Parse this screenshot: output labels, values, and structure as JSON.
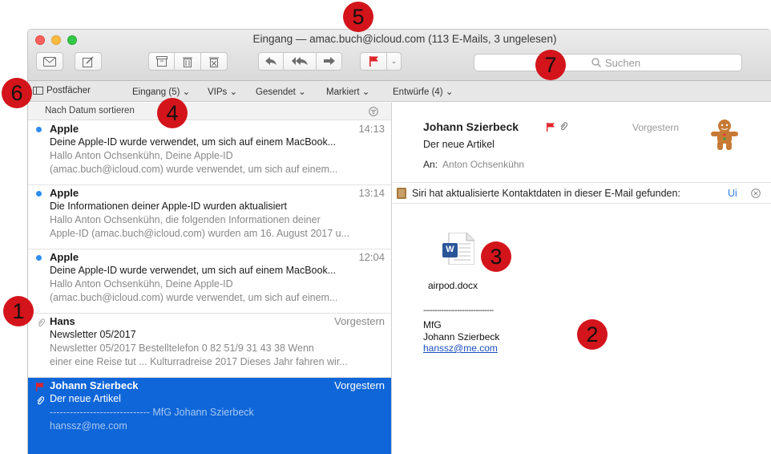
{
  "window": {
    "title": "Eingang — amac.buch@icloud.com (113 E-Mails, 3 ungelesen)"
  },
  "toolbar": {
    "buttons": [
      "new-message",
      "compose",
      "archive",
      "delete",
      "junk",
      "reply",
      "reply-all",
      "forward",
      "flag",
      "flag-menu"
    ],
    "search_placeholder": "Suchen"
  },
  "favorites": {
    "mailboxes": "Postfächer",
    "inbox": "Eingang (5)",
    "vips": "VIPs",
    "sent": "Gesendet",
    "flagged": "Markiert",
    "drafts": "Entwürfe (4)"
  },
  "list": {
    "sort_label": "Nach Datum sortieren",
    "messages": [
      {
        "sender": "Apple",
        "time": "14:13",
        "subject": "Deine Apple-ID wurde verwendet, um sich auf einem MacBook...",
        "preview1": "Hallo Anton Ochsenkühn, Deine Apple-ID",
        "preview2": "(amac.buch@icloud.com) wurde verwendet, um sich auf einem...",
        "unread": true
      },
      {
        "sender": "Apple",
        "time": "13:14",
        "subject": "Die Informationen deiner Apple-ID wurden aktualisiert",
        "preview1": "Hallo Anton Ochsenkühn, die folgenden Informationen deiner",
        "preview2": "Apple-ID (amac.buch@icloud.com) wurden am 16. August 2017 u...",
        "unread": true
      },
      {
        "sender": "Apple",
        "time": "12:04",
        "subject": "Deine Apple-ID wurde verwendet, um sich auf einem MacBook...",
        "preview1": "Hallo Anton Ochsenkühn, Deine Apple-ID",
        "preview2": "(amac.buch@icloud.com) wurde verwendet, um sich auf einem...",
        "unread": true
      },
      {
        "sender": "Hans",
        "time": "Vorgestern",
        "subject": "Newsletter 05/2017",
        "preview1": "Newsletter 05/2017 Bestelltelefon 0 82 51/9 31 43 38   Wenn",
        "preview2": "einer eine Reise tut ... Kulturradreise 2017 Dieses Jahr fahren wir...",
        "attachment": true
      },
      {
        "sender": "Johann Szierbeck",
        "time": "Vorgestern",
        "subject": "Der neue Artikel",
        "preview1": "------------------------------ MfG Johann Szierbeck",
        "preview2": "hanssz@me.com",
        "selected": true,
        "flagged": true,
        "attachment": true
      }
    ]
  },
  "reader": {
    "from": "Johann Szierbeck",
    "date": "Vorgestern",
    "subject": "Der neue Artikel",
    "to_label": "An:",
    "to": "Anton Ochsenkühn",
    "siri_text": "Siri hat aktualisierte Kontaktdaten in dieser E-Mail gefunden:",
    "siri_action": "Ui",
    "attachment_name": "airpod.docx",
    "attachment_icon_letter": "W",
    "sig_dashes": "-------------------------------",
    "sig_greeting": "MfG",
    "sig_name": "Johann Szierbeck",
    "sig_email": "hanssz@me.com"
  },
  "callouts": [
    "1",
    "2",
    "3",
    "4",
    "5",
    "6",
    "7"
  ],
  "colors": {
    "selection": "#0f66d8",
    "unread_dot": "#2f8cf0",
    "flag": "#e0242b",
    "callout": "#d3141b"
  }
}
